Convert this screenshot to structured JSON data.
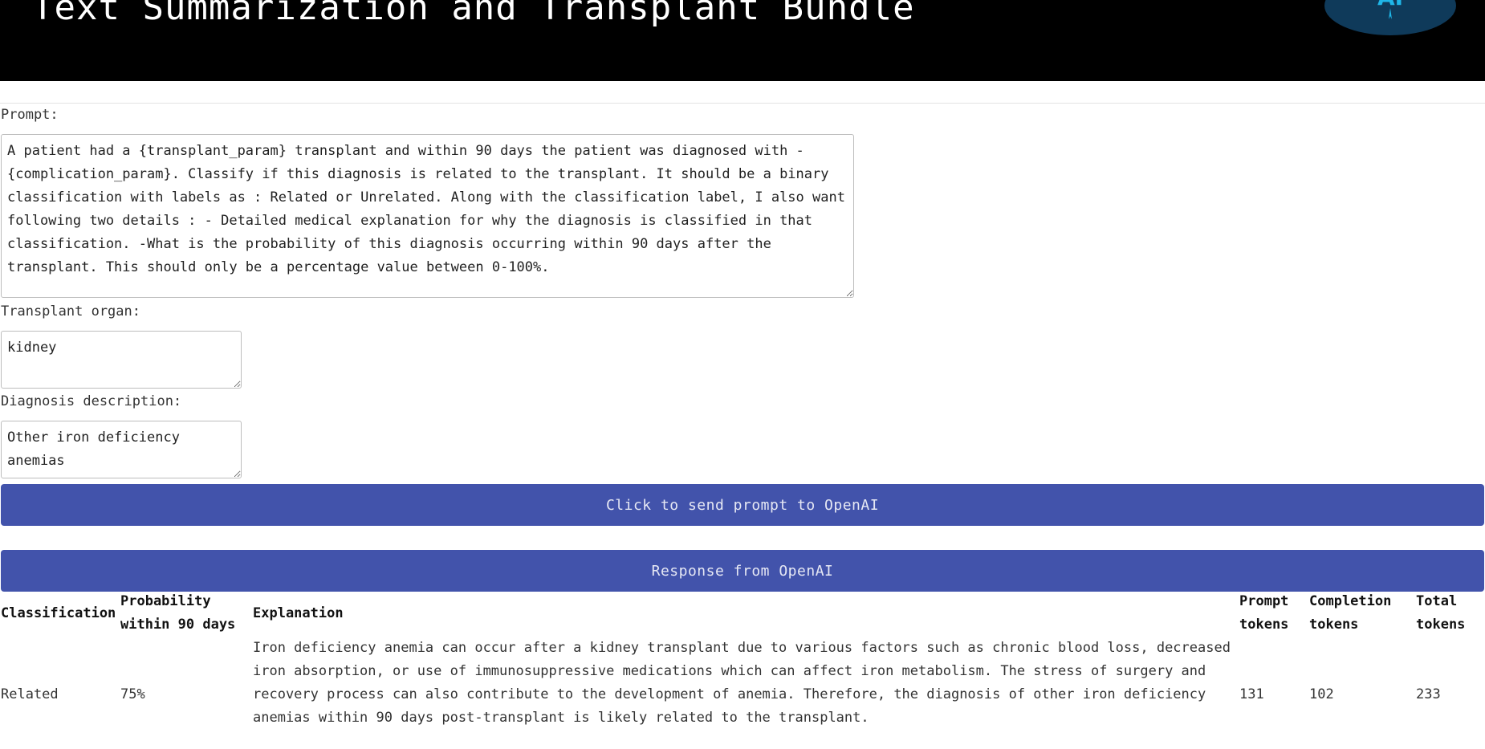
{
  "header": {
    "title": "Text Summarization and Transplant Bundle",
    "logo_text": "AI"
  },
  "form": {
    "prompt_label": "Prompt:",
    "prompt_value": "A patient had a {transplant_param} transplant and within 90 days the patient was diagnosed with - {complication_param}. Classify if this diagnosis is related to the transplant. It should be a binary classification with labels as : Related or Unrelated. Along with the classification label, I also want following two details : - Detailed medical explanation for why the diagnosis is classified in that classification. -What is the probability of this diagnosis occurring within 90 days after the transplant. This should only be a percentage value between 0-100%.",
    "organ_label": "Transplant organ:",
    "organ_value": "kidney",
    "diagnosis_label": "Diagnosis description:",
    "diagnosis_value": "Other iron deficiency anemias",
    "send_button": "Click to send prompt to OpenAI"
  },
  "response": {
    "header": "Response from OpenAI",
    "columns": {
      "classification": "Classification",
      "probability": "Probability within 90 days",
      "explanation": "Explanation",
      "prompt_tokens": "Prompt tokens",
      "completion_tokens": "Completion tokens",
      "total_tokens": "Total tokens"
    },
    "row": {
      "classification": "Related",
      "probability": "75%",
      "explanation": "Iron deficiency anemia can occur after a kidney transplant due to various factors such as chronic blood loss, decreased iron absorption, or use of immunosuppressive medications which can affect iron metabolism. The stress of surgery and recovery process can also contribute to the development of anemia. Therefore, the diagnosis of other iron deficiency anemias within 90 days post-transplant is likely related to the transplant.",
      "prompt_tokens": "131",
      "completion_tokens": "102",
      "total_tokens": "233"
    }
  }
}
